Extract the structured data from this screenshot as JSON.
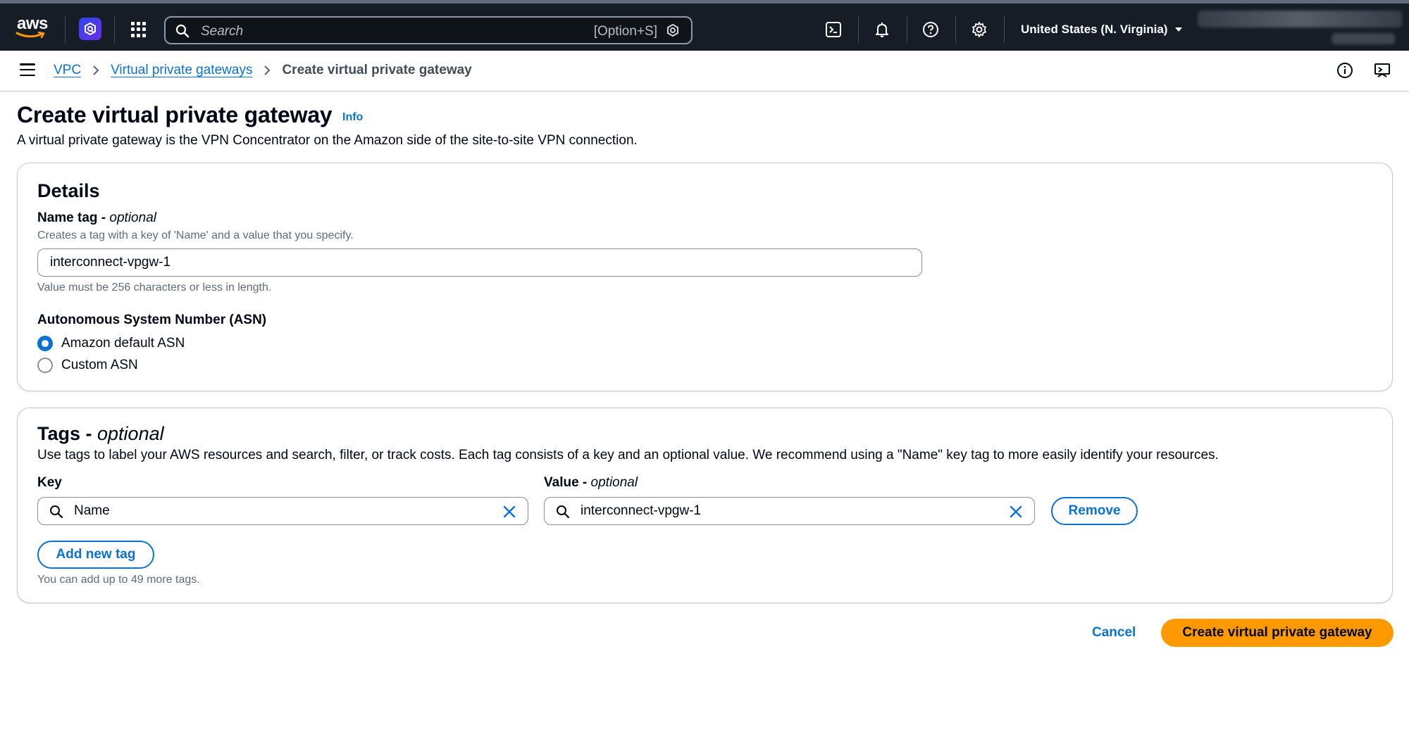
{
  "topnav": {
    "logo_text": "aws",
    "search_placeholder": "Search",
    "search_shortcut": "[Option+S]",
    "region": "United States (N. Virginia)",
    "icons": [
      "amazon-q-icon",
      "services-grid-icon",
      "search-icon",
      "cloudshell-icon",
      "notifications-icon",
      "help-icon",
      "settings-icon"
    ]
  },
  "breadcrumb": {
    "items": [
      "VPC",
      "Virtual private gateways"
    ],
    "current": "Create virtual private gateway"
  },
  "header": {
    "title": "Create virtual private gateway",
    "info": "Info",
    "description": "A virtual private gateway is the VPN Concentrator on the Amazon side of the site-to-site VPN connection."
  },
  "details": {
    "heading": "Details",
    "name_label": "Name tag - ",
    "name_label_optional": "optional",
    "name_help": "Creates a tag with a key of 'Name' and a value that you specify.",
    "name_value": "interconnect-vpgw-1",
    "name_constraint": "Value must be 256 characters or less in length.",
    "asn_label": "Autonomous System Number (ASN)",
    "asn_options": [
      {
        "label": "Amazon default ASN",
        "selected": true
      },
      {
        "label": "Custom ASN",
        "selected": false
      }
    ]
  },
  "tags": {
    "heading": "Tags - ",
    "heading_optional": "optional",
    "description": "Use tags to label your AWS resources and search, filter, or track costs. Each tag consists of a key and an optional value. We recommend using a \"Name\" key tag to more easily identify your resources.",
    "key_label": "Key",
    "value_label": "Value - ",
    "value_label_optional": "optional",
    "rows": [
      {
        "key": "Name",
        "value": "interconnect-vpgw-1"
      }
    ],
    "remove_label": "Remove",
    "add_label": "Add new tag",
    "limit_text": "You can add up to 49 more tags."
  },
  "actions": {
    "cancel": "Cancel",
    "submit": "Create virtual private gateway"
  },
  "colors": {
    "nav_bg": "#161d26",
    "link": "#0972d3",
    "primary_button": "#ff9900",
    "border": "#c6c6cd"
  }
}
